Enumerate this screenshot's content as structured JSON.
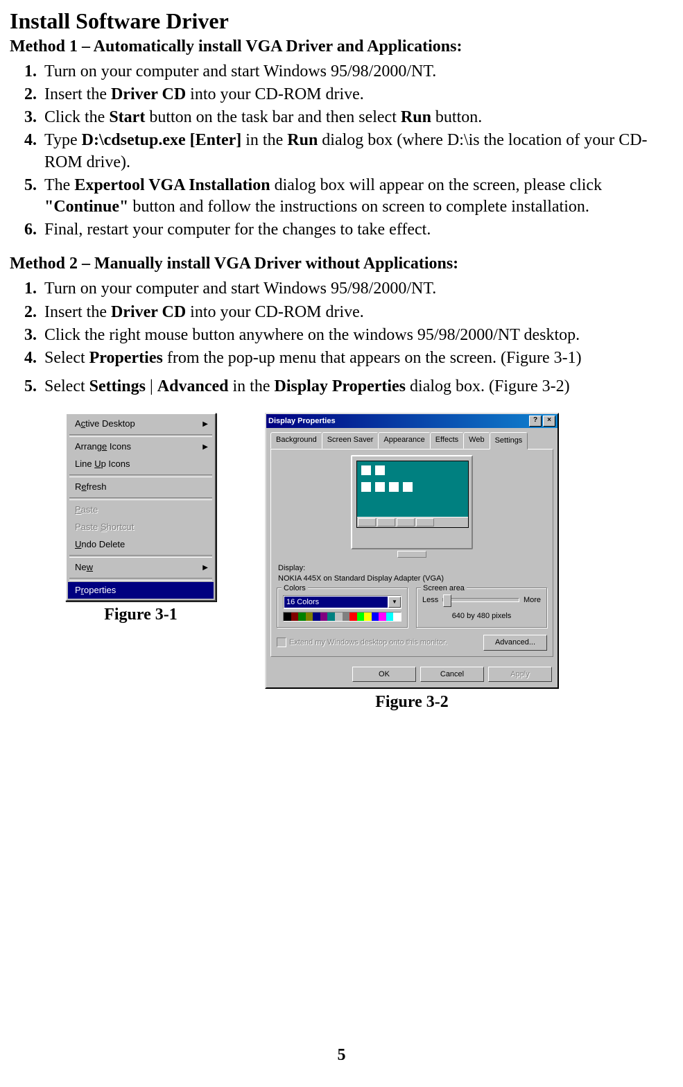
{
  "title": "Install Software Driver",
  "method1": {
    "heading": "Method 1 – Automatically install VGA Driver and Applications:",
    "steps": {
      "s1_num": "1.",
      "s1": "Turn on your computer and start Windows 95/98/2000/NT.",
      "s2_num": "2.",
      "s2_a": "Insert the ",
      "s2_b": "Driver CD",
      "s2_c": " into your CD-ROM drive.",
      "s3_num": "3.",
      "s3_a": "Click the ",
      "s3_b": "Start",
      "s3_c": " button on the task bar and then select ",
      "s3_d": "Run",
      "s3_e": " button.",
      "s4_num": "4.",
      "s4_a": "Type ",
      "s4_b": "D:\\cdsetup.exe [Enter]",
      "s4_c": " in the ",
      "s4_d": "Run",
      "s4_e": " dialog box (where D:\\is the location of your CD-ROM drive).",
      "s5_num": "5.",
      "s5_a": "The ",
      "s5_b": "Expertool VGA Installation",
      "s5_c": " dialog box will appear on the screen, please click ",
      "s5_d": "\"Continue\"",
      "s5_e": " button and follow the instructions on screen to complete installation.",
      "s6_num": "6.",
      "s6": "Final, restart your computer for the changes to take effect."
    }
  },
  "method2": {
    "heading": "Method 2 – Manually install VGA Driver without Applications:",
    "steps": {
      "s1": "Turn on your computer and start Windows 95/98/2000/NT.",
      "s2_a": "Insert the ",
      "s2_b": "Driver CD",
      "s2_c": " into your CD-ROM drive.",
      "s3": "Click the right mouse button anywhere on the windows 95/98/2000/NT desktop.",
      "s4_a": "Select ",
      "s4_b": "Properties",
      "s4_c": " from the pop-up menu that appears on the screen. (Figure 3-1)",
      "s5_a": "Select ",
      "s5_b": "Settings",
      "s5_bar": " | ",
      "s5_c": "Advanced",
      "s5_d": " in the ",
      "s5_e": "Display Properties",
      "s5_f": " dialog box. (Figure 3-2)"
    }
  },
  "context_menu": {
    "active_desktop_pre": "A",
    "active_desktop_u": "c",
    "active_desktop_post": "tive Desktop",
    "arrange_pre": "Arrang",
    "arrange_u": "e",
    "arrange_post": " Icons",
    "lineup_pre": "Line ",
    "lineup_u": "U",
    "lineup_post": "p Icons",
    "refresh_pre": "R",
    "refresh_u": "e",
    "refresh_post": "fresh",
    "paste_u": "P",
    "paste_post": "aste",
    "pastesc_pre": "Paste ",
    "pastesc_u": "S",
    "pastesc_post": "hortcut",
    "undo_u": "U",
    "undo_post": "ndo Delete",
    "new_pre": "Ne",
    "new_u": "w",
    "prop_pre": "P",
    "prop_u": "r",
    "prop_post": "operties"
  },
  "dialog": {
    "title": "Display Properties",
    "tabs": {
      "background": "Background",
      "screensaver": "Screen Saver",
      "appearance": "Appearance",
      "effects": "Effects",
      "web": "Web",
      "settings": "Settings"
    },
    "display_label": "Display:",
    "display_value": "NOKIA 445X on Standard Display Adapter (VGA)",
    "colors": {
      "title": "Colors",
      "value": "16 Colors"
    },
    "screen_area": {
      "title": "Screen area",
      "less": "Less",
      "more": "More",
      "value": "640 by 480 pixels"
    },
    "extend": "Extend my Windows desktop onto this monitor.",
    "advanced": "Advanced...",
    "ok": "OK",
    "cancel": "Cancel",
    "apply": "Apply"
  },
  "captions": {
    "fig1": "Figure 3-1",
    "fig2": "Figure 3-2"
  },
  "page_num": "5"
}
